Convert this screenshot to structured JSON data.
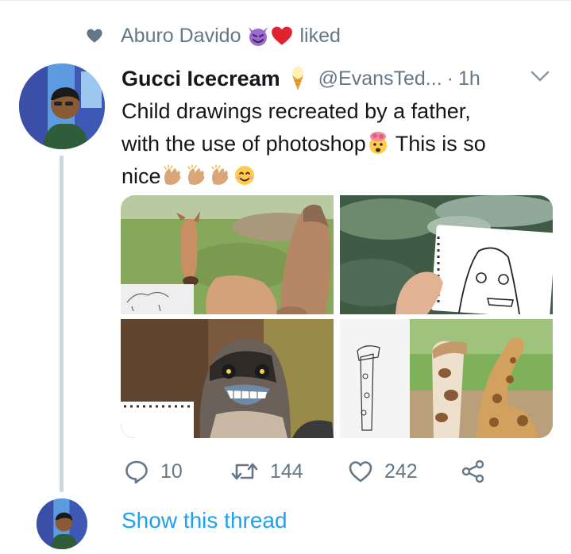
{
  "context": {
    "liker_name": "Aburo Davido",
    "liked_label": "liked"
  },
  "tweet": {
    "display_name": "Gucci Icecream",
    "handle": "@EvansTed...",
    "separator": "·",
    "time": "1h",
    "text_line1": "Child drawings recreated by a father,",
    "text_line2a": "with the use of photoshop",
    "text_line2b": " This is so",
    "text_line3": "nice"
  },
  "media": {
    "items": [
      "horse-photo",
      "ghost-drawing-photo",
      "bird-photo",
      "giraffe-photo"
    ]
  },
  "actions": {
    "replies": "10",
    "retweets": "144",
    "likes": "242"
  },
  "thread": {
    "show_label": "Show this thread"
  },
  "colors": {
    "accent": "#1da1f2",
    "secondary_text": "#657786",
    "primary_text": "#14171a",
    "thread_line": "#ccd6dd"
  }
}
